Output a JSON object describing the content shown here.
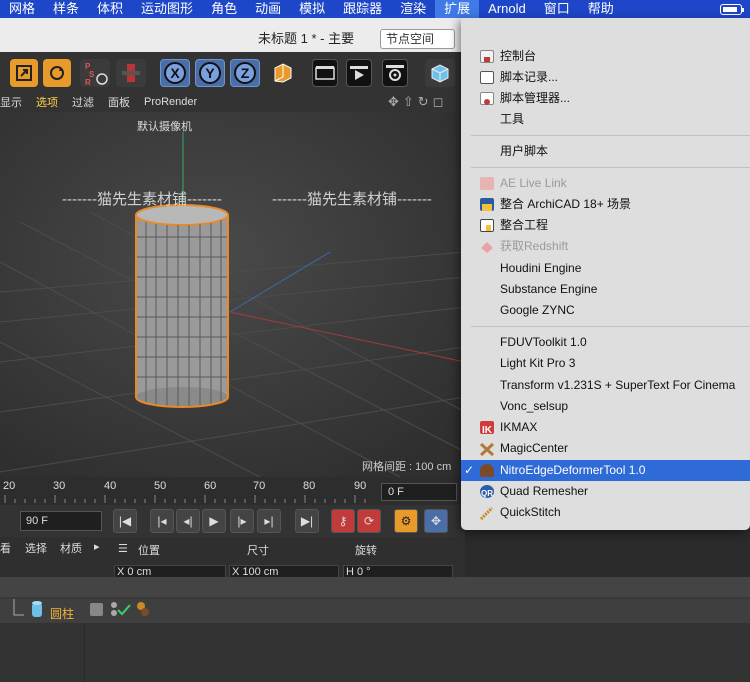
{
  "menubar": {
    "items": [
      "网格",
      "样条",
      "体积",
      "运动图形",
      "角色",
      "动画",
      "模拟",
      "跟踪器",
      "渲染",
      "扩展",
      "Arnold",
      "窗口",
      "帮助"
    ],
    "active_index": 9
  },
  "titlebar": {
    "title": "未标题 1 * - 主要",
    "node_space": "节点空间"
  },
  "modebar": {
    "items": [
      "显示",
      "选项",
      "过滤",
      "面板",
      "ProRender"
    ]
  },
  "viewport": {
    "camera": "默认摄像机",
    "grid_spacing": "网格间距 : 100 cm",
    "watermark": "-------猫先生素材铺-------"
  },
  "timeline": {
    "ticks": [
      "20",
      "30",
      "40",
      "50",
      "60",
      "70",
      "80",
      "90"
    ],
    "current_frame": "0 F"
  },
  "transport": {
    "end_frame": "90 F"
  },
  "attributes": {
    "tabs": [
      "看",
      "选择",
      "材质"
    ],
    "columns": [
      "位置",
      "尺寸",
      "旋转"
    ],
    "x_pos": "X  0 cm",
    "x_size": "X  100 cm",
    "h_rot": "H  0 °"
  },
  "object_manager": {
    "object": "圆柱"
  },
  "menu": {
    "items": [
      {
        "label": "控制台",
        "icon": "console-icon",
        "color": "#c23b3b"
      },
      {
        "label": "脚本记录...",
        "icon": "script-log-icon",
        "color": "#555555"
      },
      {
        "label": "脚本管理器...",
        "icon": "script-manager-icon",
        "color": "#c23b3b"
      },
      {
        "label": "工具"
      },
      {
        "label": "用户脚本"
      },
      {
        "label": "AE Live Link",
        "icon": "ae-icon",
        "color": "#c86b6b",
        "disabled": true
      },
      {
        "label": "整合 ArchiCAD 18+ 场景",
        "icon": "archicad-icon",
        "color": "#2c5aa0"
      },
      {
        "label": "整合工程",
        "icon": "merge-icon",
        "color": "#444444"
      },
      {
        "label": "获取Redshift",
        "icon": "redshift-icon",
        "color": "#e07070",
        "disabled": true
      },
      {
        "label": "Houdini Engine"
      },
      {
        "label": "Substance Engine"
      },
      {
        "label": "Google ZYNC"
      },
      {
        "label": "FDUVToolkit 1.0"
      },
      {
        "label": "Light Kit Pro 3"
      },
      {
        "label": "Transform v1.231S + SuperText For Cinema"
      },
      {
        "label": "Vonc_selsup"
      },
      {
        "label": "IKMAX",
        "icon": "ikmax-icon",
        "color": "#d23b3b"
      },
      {
        "label": "MagicCenter",
        "icon": "magic-center-icon",
        "color": "#b07a3a"
      },
      {
        "label": "NitroEdgeDeformerTool 1.0",
        "icon": "nitro-icon",
        "color": "#7b4a2a",
        "highlight": true,
        "checked": true
      },
      {
        "label": "Quad Remesher",
        "icon": "quad-remesher-icon",
        "color": "#2d5ba8"
      },
      {
        "label": "QuickStitch",
        "icon": "quickstitch-icon",
        "color": "#c98a2a"
      }
    ],
    "check_mark": "✓"
  }
}
